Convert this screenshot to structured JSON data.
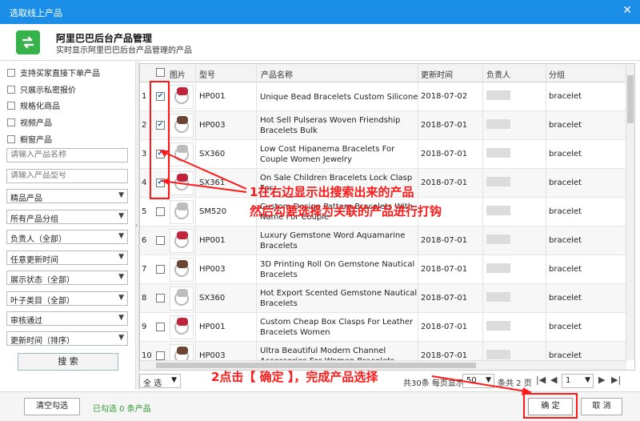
{
  "window": {
    "title": "选取线上产品",
    "close_glyph": "✕"
  },
  "header": {
    "title": "阿里巴巴后台产品管理",
    "subtitle": "实时显示阿里巴巴后台产品管理的产品",
    "logo_color": "#36b24a"
  },
  "filters": {
    "checkboxes": [
      "支持买家直接下单产品",
      "只展示私密报价",
      "规格化商品",
      "视频产品",
      "橱窗产品"
    ],
    "name_placeholder": "请输入产品名称",
    "model_placeholder": "请输入产品型号",
    "selects": [
      "精品产品",
      "所有产品分组",
      "负责人（全部）",
      "任意更新时间",
      "展示状态（全部）",
      "叶子类目（全部）",
      "审核通过",
      "更新时间（排序）"
    ],
    "search_label": "搜  索"
  },
  "table": {
    "headers": {
      "image": "图片",
      "model": "型号",
      "name": "产品名称",
      "updated": "更新时间",
      "owner": "负责人",
      "group": "分组"
    },
    "rows": [
      {
        "n": "1",
        "checked": true,
        "model": "HP001",
        "name": "Unique Bead Bracelets Custom Silicone",
        "date": "2018-07-02",
        "group": "bracelet",
        "gem": "#c2233a"
      },
      {
        "n": "2",
        "checked": true,
        "model": "HP003",
        "name": "Hot Sell Pulseras Woven Friendship Bracelets Bulk",
        "date": "2018-07-01",
        "group": "bracelet",
        "gem": "#6a4632"
      },
      {
        "n": "3",
        "checked": true,
        "model": "SX360",
        "name": "Low Cost Hipanema Bracelets For Couple Women Jewelry",
        "date": "2018-07-01",
        "group": "bracelet",
        "gem": "#bdbdbd"
      },
      {
        "n": "4",
        "checked": true,
        "model": "SX361",
        "name": "On Sale Children Bracelets Lock Clasp For",
        "date": "2018-07-01",
        "group": "bracelet",
        "gem": "#c2233a"
      },
      {
        "n": "5",
        "checked": false,
        "model": "SM520",
        "name": "Custom Design Pattern Bracelets With Name For Couple",
        "date": "",
        "group": "bracelet",
        "gem": "#bdbdbd"
      },
      {
        "n": "6",
        "checked": false,
        "model": "HP001",
        "name": "Luxury Gemstone Word Aquamarine Bracelets",
        "date": "2018-07-01",
        "group": "bracelet",
        "gem": "#c2233a"
      },
      {
        "n": "7",
        "checked": false,
        "model": "HP003",
        "name": "3D Printing Roll On Gemstone Nautical Bracelets",
        "date": "2018-07-01",
        "group": "bracelet",
        "gem": "#6a4632"
      },
      {
        "n": "8",
        "checked": false,
        "model": "SX360",
        "name": "Hot Export Scented Gemstone Nautical Bracelets",
        "date": "2018-07-01",
        "group": "bracelet",
        "gem": "#bdbdbd"
      },
      {
        "n": "9",
        "checked": false,
        "model": "HP001",
        "name": "Custom Cheap Box Clasps For Leather Bracelets Women",
        "date": "2018-07-01",
        "group": "bracelet",
        "gem": "#c2233a"
      },
      {
        "n": "10",
        "checked": false,
        "model": "HP003",
        "name": "Ultra Beautiful Modern Channel Accessories For Women Bracelets Jewelry",
        "date": "2018-07-01",
        "group": "bracelet",
        "gem": "#6a4632"
      }
    ]
  },
  "pager": {
    "select_all": "全 选",
    "total": "共30条 每页显示",
    "page_size": "50",
    "pages": "条共 2 页",
    "page": "1"
  },
  "footer": {
    "clear": "清空勾选",
    "selected": "已勾选 0 条产品",
    "ok": "确 定",
    "cancel": "取 消"
  },
  "annotations": {
    "line1": "1在右边显示出搜索出来的产品",
    "line2": "然后勾要选择为关联的产品进行打钩",
    "line3": "2点击【 确定 】，完成产品选择",
    "color": "#ff1818"
  }
}
